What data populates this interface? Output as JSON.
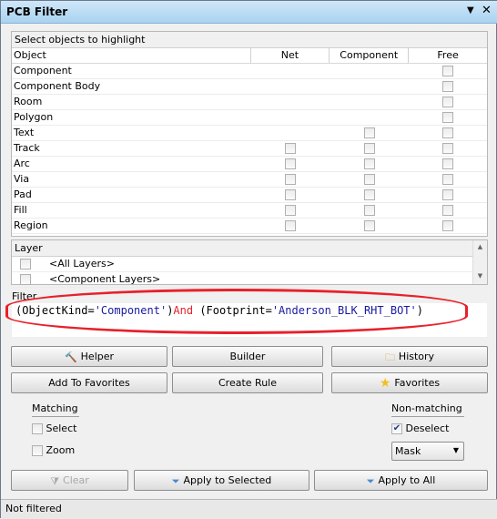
{
  "window": {
    "title": "PCB Filter",
    "menu_icon": "dropdown-arrow",
    "close_icon": "close"
  },
  "objects": {
    "header": "Select objects to highlight",
    "columns": [
      "Object",
      "Net",
      "Component",
      "Free"
    ],
    "rows": [
      {
        "label": "Component",
        "net": false,
        "component": false,
        "free": true
      },
      {
        "label": "Component Body",
        "net": false,
        "component": false,
        "free": true
      },
      {
        "label": "Room",
        "net": false,
        "component": false,
        "free": true
      },
      {
        "label": "Polygon",
        "net": false,
        "component": false,
        "free": true
      },
      {
        "label": "Text",
        "net": false,
        "component": true,
        "free": true
      },
      {
        "label": "Track",
        "net": true,
        "component": true,
        "free": true
      },
      {
        "label": "Arc",
        "net": true,
        "component": true,
        "free": true
      },
      {
        "label": "Via",
        "net": true,
        "component": true,
        "free": true
      },
      {
        "label": "Pad",
        "net": true,
        "component": true,
        "free": true
      },
      {
        "label": "Fill",
        "net": true,
        "component": true,
        "free": true
      },
      {
        "label": "Region",
        "net": true,
        "component": true,
        "free": true
      }
    ]
  },
  "layer": {
    "header": "Layer",
    "items": [
      "<All Layers>",
      "<Component Layers>"
    ]
  },
  "filter": {
    "label": "Filter",
    "p1": "(ObjectKind=",
    "v1": "'Component'",
    "p2": ")",
    "kw": "And",
    "p3": " (Footprint=",
    "v2": "'Anderson_BLK_RHT_BOT'",
    "p4": ")"
  },
  "buttons": {
    "helper": "Helper",
    "builder": "Builder",
    "history": "History",
    "add_fav": "Add To Favorites",
    "create_rule": "Create Rule",
    "favorites": "Favorites",
    "clear": "Clear",
    "apply_selected": "Apply to Selected",
    "apply_all": "Apply to All"
  },
  "matching": {
    "label": "Matching",
    "select": "Select",
    "zoom": "Zoom"
  },
  "nonmatching": {
    "label": "Non-matching",
    "deselect": "Deselect",
    "deselect_checked": true,
    "mode": "Mask"
  },
  "status": "Not filtered",
  "colors": {
    "highlight_ellipse": "#e8202a",
    "keyword": "#e8202a",
    "string": "#1a1aa0"
  }
}
